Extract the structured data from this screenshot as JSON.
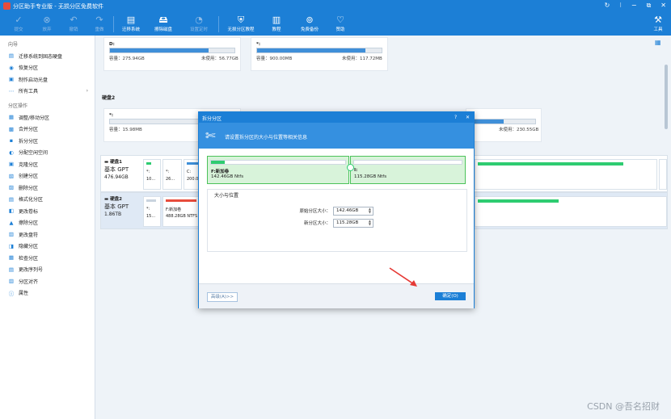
{
  "window": {
    "title": "分区助手专业版 - 无损分区免费软件",
    "controls": [
      "↻",
      "⁝",
      "−",
      "⧉",
      "✕"
    ]
  },
  "toolbar": {
    "items": [
      {
        "label": "提交",
        "icon": "check-icon",
        "glyph": "✓"
      },
      {
        "label": "放弃",
        "icon": "cancel-icon",
        "glyph": "⊗"
      },
      {
        "label": "撤销",
        "icon": "undo-icon",
        "glyph": "↶"
      },
      {
        "label": "重做",
        "icon": "redo-icon",
        "glyph": "↷"
      },
      {
        "label": "迁移系统",
        "icon": "migrate-icon",
        "glyph": "▤"
      },
      {
        "label": "擦除磁盘",
        "icon": "wipe-icon",
        "glyph": "🖴"
      },
      {
        "label": "设置定时",
        "icon": "timer-icon",
        "glyph": "◔"
      },
      {
        "label": "无损分区教程",
        "icon": "shield-icon",
        "glyph": "⛨"
      },
      {
        "label": "教程",
        "icon": "doc-icon",
        "glyph": "▥"
      },
      {
        "label": "免费备份",
        "icon": "backup-icon",
        "glyph": "⊚"
      },
      {
        "label": "赞助",
        "icon": "heart-icon",
        "glyph": "♡"
      },
      {
        "label": "工具",
        "icon": "tools-icon",
        "glyph": "⚒"
      }
    ]
  },
  "sidebar": {
    "wizard_title": "向导",
    "wizard_items": [
      {
        "label": "迁移系统到固态硬盘",
        "glyph": "▤"
      },
      {
        "label": "恢复分区",
        "glyph": "◉"
      },
      {
        "label": "制作启动光盘",
        "glyph": "▣"
      },
      {
        "label": "所有工具",
        "glyph": "⋯",
        "chev": "›"
      }
    ],
    "ops_title": "分区操作",
    "ops_items": [
      {
        "label": "调整/移动分区",
        "glyph": "▦"
      },
      {
        "label": "合并分区",
        "glyph": "▩"
      },
      {
        "label": "拆分分区",
        "glyph": "▪"
      },
      {
        "label": "分配空闲空间",
        "glyph": "◐"
      },
      {
        "label": "克隆分区",
        "glyph": "▣"
      },
      {
        "label": "创建分区",
        "glyph": "▧"
      },
      {
        "label": "删除分区",
        "glyph": "▨"
      },
      {
        "label": "格式化分区",
        "glyph": "▤"
      },
      {
        "label": "更改卷标",
        "glyph": "◧"
      },
      {
        "label": "擦除分区",
        "glyph": "▲"
      },
      {
        "label": "更改盘符",
        "glyph": "▥"
      },
      {
        "label": "隐藏分区",
        "glyph": "◨"
      },
      {
        "label": "检查分区",
        "glyph": "▦"
      },
      {
        "label": "更改序列号",
        "glyph": "▤"
      },
      {
        "label": "分区对齐",
        "glyph": "▥"
      },
      {
        "label": "属性",
        "glyph": "ⓘ"
      }
    ]
  },
  "cards": {
    "d": {
      "name": "D:",
      "cap": "容量：275.94GB",
      "free": "未使用：56.77GB",
      "usage": 0.79
    },
    "star1": {
      "name": "*:",
      "cap": "容量：900.00MB",
      "free": "未使用：117.72MB",
      "usage": 0.87
    },
    "disk2_label": "硬盘2",
    "star2": {
      "name": "*:",
      "cap": "容量：15.98MB",
      "usage": 0.0
    },
    "right": {
      "free": "未使用：230.55GB",
      "usage": 0.5
    }
  },
  "disks": [
    {
      "name": "硬盘1",
      "type": "基本 GPT",
      "size": "476.94GB",
      "parts": [
        {
          "l": "*:",
          "s": "10..."
        },
        {
          "l": "*:",
          "s": "26..."
        },
        {
          "l": "C:",
          "s": "200.0..."
        }
      ]
    },
    {
      "name": "硬盘2",
      "type": "基本 GPT",
      "size": "1.86TB",
      "parts": [
        {
          "l": "*:",
          "s": "15..."
        },
        {
          "l": "F:新加卷",
          "s": "488.28GB NTFS"
        }
      ]
    }
  ],
  "dialog": {
    "title": "拆分分区",
    "banner": "请设置拆分区的大小与位置等相关信息",
    "left": {
      "name": "F:新加卷",
      "size": "142.46GB Ntfs"
    },
    "right": {
      "name": "I:",
      "size": "115.28GB Ntfs"
    },
    "section": "大小与位置",
    "orig_label": "原始分区大小：",
    "orig_value": "142.46GB",
    "new_label": "新分区大小：",
    "new_value": "115.28GB",
    "adv": "高级(A)>>",
    "ok": "确定(O)",
    "help": "?",
    "close": "✕"
  },
  "watermark": "CSDN @吾名招财"
}
